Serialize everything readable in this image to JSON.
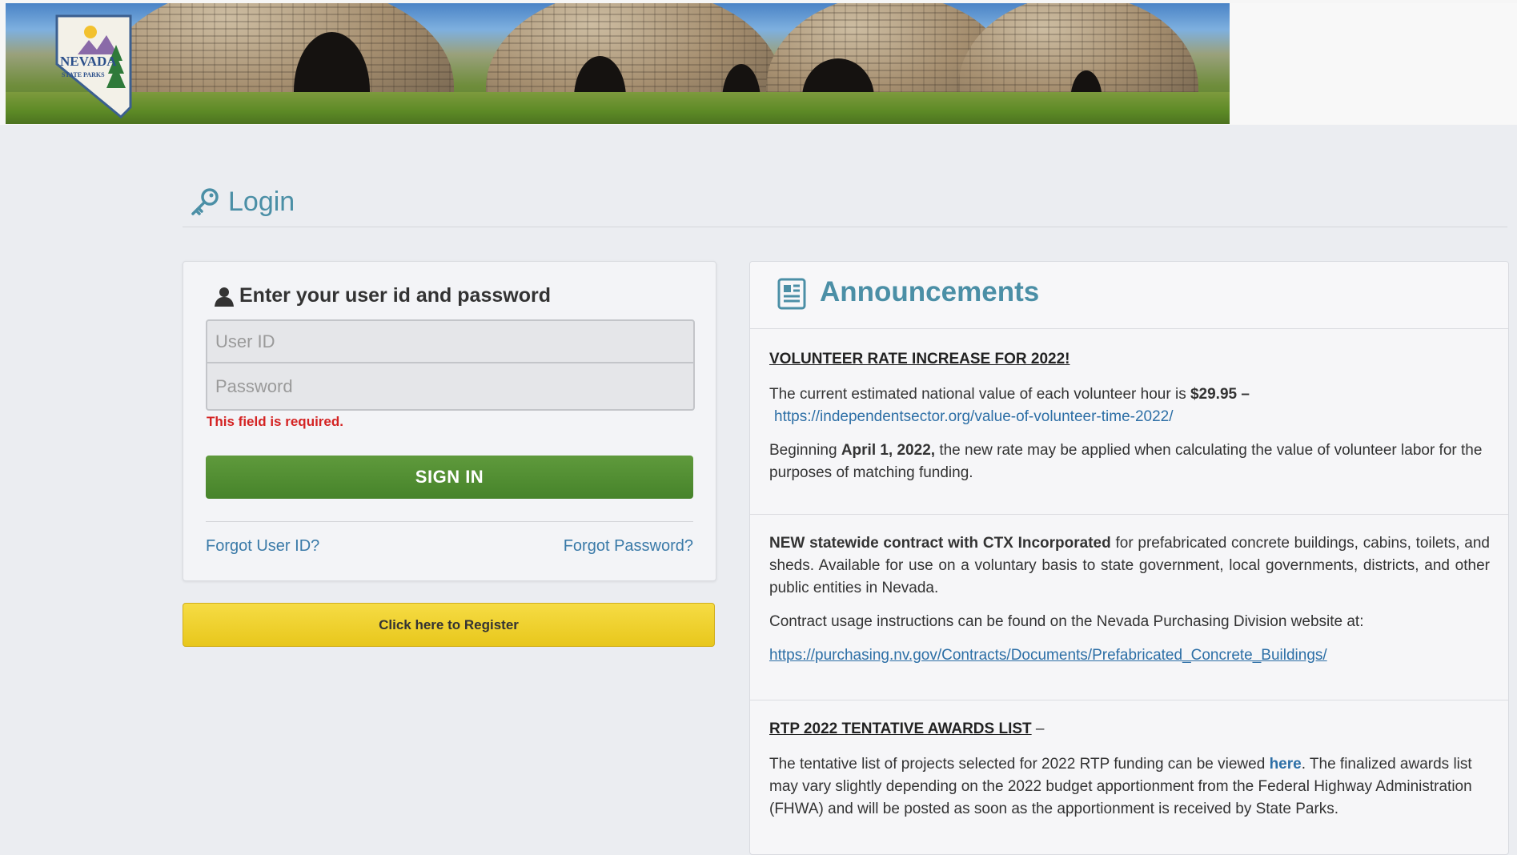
{
  "banner": {
    "logo_top": "NEVADA",
    "logo_bottom": "STATE PARKS"
  },
  "login_header": {
    "title": "Login"
  },
  "login_form": {
    "heading": "Enter your user id and password",
    "user_id_placeholder": "User ID",
    "password_placeholder": "Password",
    "error_text": "This field is required.",
    "signin_label": "SIGN IN",
    "forgot_user_id": "Forgot User ID?",
    "forgot_password": "Forgot Password?"
  },
  "register": {
    "label": "Click here to Register"
  },
  "announcements": {
    "title": "Announcements",
    "item1": {
      "title": "VOLUNTEER RATE INCREASE FOR 2022!",
      "line1_text": "The current estimated national value of each volunteer hour is",
      "line1_bold": "$29.95 –",
      "link": "https://independentsector.org/value-of-volunteer-time-2022/",
      "p2_a": "Beginning",
      "p2_bold": "April 1, 2022,",
      "p2_b": "the new rate may be applied when calculating the value of volunteer labor for the purposes of matching funding."
    },
    "item2": {
      "bold": "NEW statewide contract with CTX Incorporated",
      "text": "for prefabricated concrete buildings, cabins, toilets, and sheds. Available for use on a voluntary basis to state government, local governments, districts, and other public entities in Nevada.",
      "p2": "Contract usage instructions can be found on the Nevada Purchasing Division website at:",
      "link": "https://purchasing.nv.gov/Contracts/Documents/Prefabricated_Concrete_Buildings/"
    },
    "item3": {
      "title": "RTP 2022 TENTATIVE AWARDS LIST",
      "title_suffix": " –",
      "p_a": "The tentative list of projects selected for 2022 RTP funding can be viewed",
      "p_link": "here",
      "p_b": ". The finalized awards list may vary slightly depending on the 2022 budget apportionment from the Federal Highway Administration (FHWA) and will be posted as soon as the apportionment is received by State Parks."
    }
  },
  "colors": {
    "accent": "#4b8fa6",
    "signin_green": "#4f8c30",
    "register_yellow": "#eccd28",
    "error_red": "#d42323",
    "link_blue": "#2d6fa6"
  }
}
